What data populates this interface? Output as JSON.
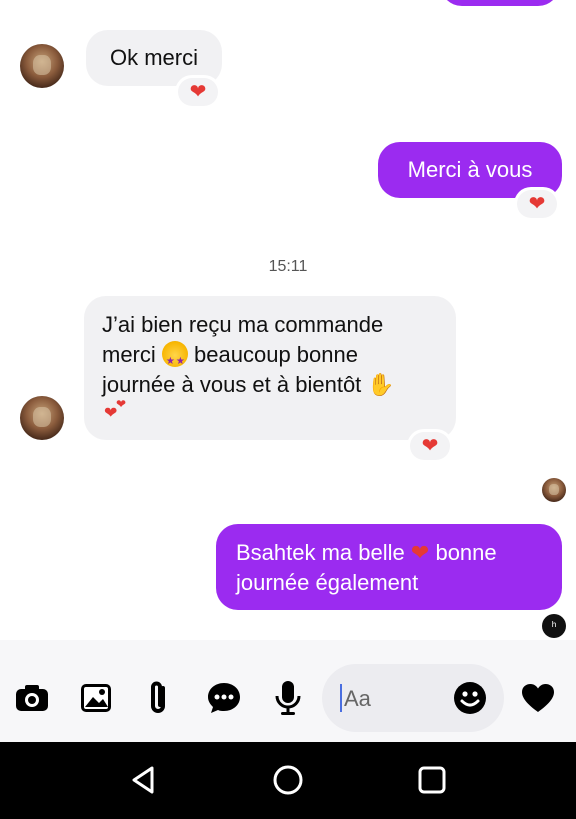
{
  "messages": {
    "m1_text": "Ok merci",
    "m2_text": "Merci à vous",
    "timestamp": "15:11",
    "m3_line1": "J’ai bien reçu ma commande",
    "m3_line2a": "merci",
    "m3_line2b": "beaucoup bonne",
    "m3_line3": "journée à vous et à bientôt",
    "m4_line1a": "Bsahtek ma belle",
    "m4_line1b": "bonne",
    "m4_line2": "journée également"
  },
  "composer": {
    "placeholder": "Aa"
  },
  "icons": {
    "camera": "camera-icon",
    "image": "image-icon",
    "attach": "paperclip-icon",
    "chat": "chat-bubble-icon",
    "mic": "microphone-icon",
    "emoji": "smiley-icon",
    "like": "heart-icon",
    "back": "back-triangle-icon",
    "home": "home-circle-icon",
    "recents": "recents-square-icon"
  },
  "colors": {
    "outgoing_bubble": "#9b2bf0",
    "incoming_bubble": "#f1f1f3",
    "reaction_heart": "#e53935",
    "nav_bar": "#000000"
  }
}
